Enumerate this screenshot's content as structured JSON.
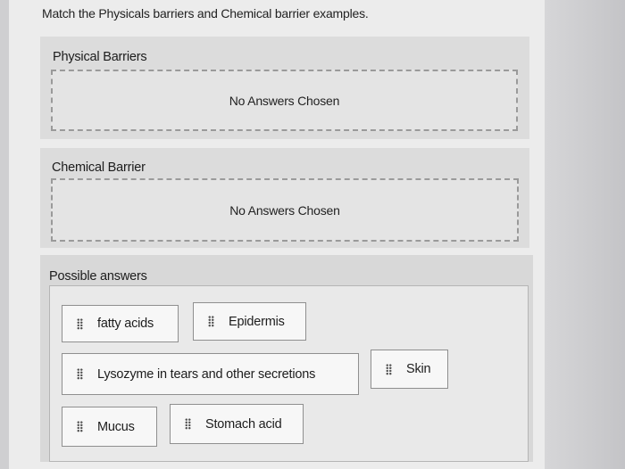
{
  "question": "Match the Physicals barriers and Chemical barrier examples.",
  "targets": [
    {
      "title": "Physical Barriers",
      "placeholder": "No Answers Chosen"
    },
    {
      "title": "Chemical Barrier",
      "placeholder": "No Answers Chosen"
    }
  ],
  "answers": {
    "title": "Possible answers",
    "items": [
      {
        "label": "fatty acids",
        "icon": "drag-handle-icon"
      },
      {
        "label": "Epidermis",
        "icon": "drag-handle-icon"
      },
      {
        "label": "Lysozyme in tears and other secretions",
        "icon": "drag-handle-icon"
      },
      {
        "label": "Skin",
        "icon": "drag-handle-icon"
      },
      {
        "label": "Mucus",
        "icon": "drag-handle-icon"
      },
      {
        "label": "Stomach acid",
        "icon": "drag-handle-icon"
      }
    ]
  }
}
